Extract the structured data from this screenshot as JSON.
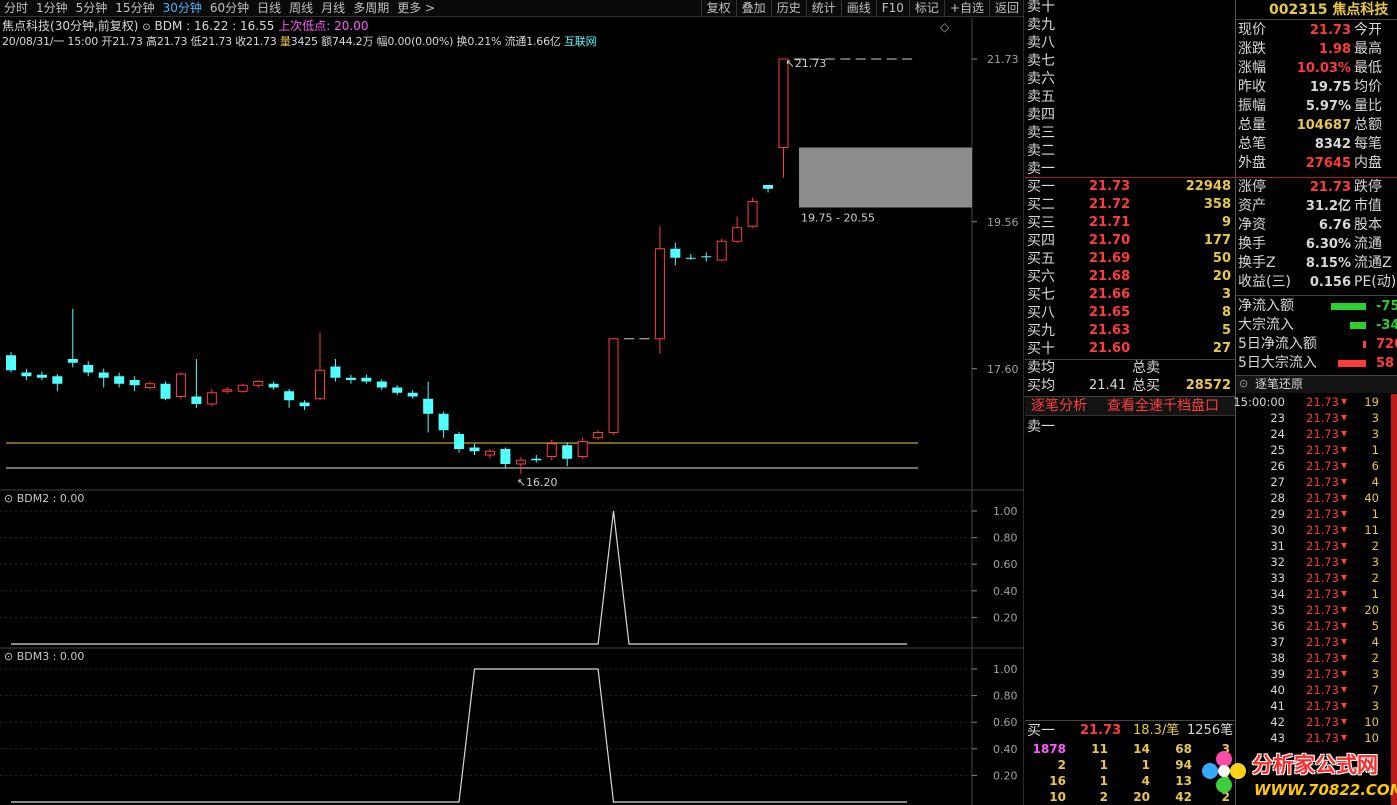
{
  "toolbar": {
    "timeframes": [
      "分时",
      "1分钟",
      "5分钟",
      "15分钟",
      "30分钟",
      "60分钟",
      "日线",
      "周线",
      "月线",
      "多周期",
      "更多 >"
    ],
    "selected_index": 4,
    "tools": [
      "复权",
      "叠加",
      "历史",
      "统计",
      "画线",
      "F10",
      "标记",
      "+自选",
      "返回"
    ]
  },
  "chart_header": {
    "stock": "焦点科技",
    "mode": "(30分钟,前复权)",
    "indicator": "BDM : 16.22 : 16.55",
    "last_low_label": "上次低点",
    "last_low_value": "20.00"
  },
  "bar_info": {
    "date": "20/08/31/一 15:00",
    "open_l": "开",
    "open": "21.73",
    "high_l": "高",
    "high": "21.73",
    "low_l": "低",
    "low": "21.73",
    "close_l": "收",
    "close": "21.73",
    "vol_l": "量",
    "vol": "3425",
    "amt_l": "额",
    "amt": "744.2万",
    "chg_l": "幅",
    "chg": "0.00(0.00%)",
    "turn_l": "换",
    "turn": "0.21%",
    "float_l": "流通",
    "float": "1.66亿",
    "sector": "互联网"
  },
  "price_axis": [
    "21.73",
    "19.56",
    "17.60"
  ],
  "chart_labels": {
    "high": "21.73",
    "low": "16.20",
    "box": "19.75 - 20.55"
  },
  "sub1": {
    "title": "BDM2 : 0.00",
    "ticks": [
      "1.00",
      "0.80",
      "0.60",
      "0.40",
      "0.20"
    ]
  },
  "sub2": {
    "title": "BDM3 : 0.00",
    "ticks": [
      "1.00",
      "0.80",
      "0.60",
      "0.40",
      "0.20"
    ]
  },
  "candles": [
    {
      "o": 17.58,
      "c": 17.78,
      "h": 17.82,
      "l": 17.55,
      "up": false
    },
    {
      "o": 17.55,
      "c": 17.5,
      "h": 17.6,
      "l": 17.45,
      "up": false
    },
    {
      "o": 17.52,
      "c": 17.48,
      "h": 17.56,
      "l": 17.45,
      "up": false
    },
    {
      "o": 17.5,
      "c": 17.4,
      "h": 17.53,
      "l": 17.3,
      "up": false
    },
    {
      "o": 17.73,
      "c": 17.68,
      "h": 18.4,
      "l": 17.62,
      "up": false
    },
    {
      "o": 17.65,
      "c": 17.55,
      "h": 17.7,
      "l": 17.5,
      "up": false
    },
    {
      "o": 17.55,
      "c": 17.48,
      "h": 17.6,
      "l": 17.35,
      "up": false
    },
    {
      "o": 17.5,
      "c": 17.4,
      "h": 17.55,
      "l": 17.35,
      "up": false
    },
    {
      "o": 17.45,
      "c": 17.38,
      "h": 17.5,
      "l": 17.3,
      "up": false
    },
    {
      "o": 17.35,
      "c": 17.4,
      "h": 17.43,
      "l": 17.32,
      "up": true
    },
    {
      "o": 17.4,
      "c": 17.2,
      "h": 17.43,
      "l": 17.18,
      "up": false
    },
    {
      "o": 17.23,
      "c": 17.53,
      "h": 17.55,
      "l": 17.2,
      "up": true
    },
    {
      "o": 17.23,
      "c": 17.13,
      "h": 17.73,
      "l": 17.08,
      "up": false
    },
    {
      "o": 17.13,
      "c": 17.28,
      "h": 17.33,
      "l": 17.1,
      "up": true
    },
    {
      "o": 17.3,
      "c": 17.32,
      "h": 17.35,
      "l": 17.27,
      "up": true
    },
    {
      "o": 17.3,
      "c": 17.38,
      "h": 17.4,
      "l": 17.28,
      "up": true
    },
    {
      "o": 17.38,
      "c": 17.43,
      "h": 17.45,
      "l": 17.35,
      "up": true
    },
    {
      "o": 17.4,
      "c": 17.35,
      "h": 17.43,
      "l": 17.32,
      "up": false
    },
    {
      "o": 17.3,
      "c": 17.18,
      "h": 17.33,
      "l": 17.08,
      "up": false
    },
    {
      "o": 17.15,
      "c": 17.1,
      "h": 17.18,
      "l": 17.05,
      "up": false
    },
    {
      "o": 17.2,
      "c": 17.58,
      "h": 18.08,
      "l": 17.18,
      "up": true
    },
    {
      "o": 17.63,
      "c": 17.48,
      "h": 17.73,
      "l": 17.43,
      "up": false
    },
    {
      "o": 17.48,
      "c": 17.45,
      "h": 17.52,
      "l": 17.4,
      "up": false
    },
    {
      "o": 17.48,
      "c": 17.43,
      "h": 17.52,
      "l": 17.4,
      "up": false
    },
    {
      "o": 17.43,
      "c": 17.35,
      "h": 17.46,
      "l": 17.32,
      "up": false
    },
    {
      "o": 17.35,
      "c": 17.28,
      "h": 17.38,
      "l": 17.25,
      "up": false
    },
    {
      "o": 17.28,
      "c": 17.23,
      "h": 17.31,
      "l": 17.2,
      "up": false
    },
    {
      "o": 17.2,
      "c": 17.0,
      "h": 17.43,
      "l": 16.75,
      "up": false
    },
    {
      "o": 17.0,
      "c": 16.78,
      "h": 17.03,
      "l": 16.68,
      "up": false
    },
    {
      "o": 16.73,
      "c": 16.53,
      "h": 16.76,
      "l": 16.48,
      "up": false
    },
    {
      "o": 16.55,
      "c": 16.5,
      "h": 16.6,
      "l": 16.45,
      "up": false
    },
    {
      "o": 16.45,
      "c": 16.5,
      "h": 16.53,
      "l": 16.4,
      "up": true
    },
    {
      "o": 16.53,
      "c": 16.33,
      "h": 16.55,
      "l": 16.28,
      "up": false
    },
    {
      "o": 16.33,
      "c": 16.38,
      "h": 16.42,
      "l": 16.2,
      "up": true
    },
    {
      "o": 16.4,
      "c": 16.38,
      "h": 16.45,
      "l": 16.35,
      "up": false
    },
    {
      "o": 16.43,
      "c": 16.6,
      "h": 16.65,
      "l": 16.38,
      "up": true
    },
    {
      "o": 16.58,
      "c": 16.4,
      "h": 16.62,
      "l": 16.3,
      "up": false
    },
    {
      "o": 16.43,
      "c": 16.63,
      "h": 16.68,
      "l": 16.4,
      "up": true
    },
    {
      "o": 16.68,
      "c": 16.75,
      "h": 16.78,
      "l": 16.65,
      "up": true
    },
    {
      "o": 16.75,
      "c": 18.0,
      "h": 18.0,
      "l": 16.72,
      "up": true
    },
    {
      "o": 18.0,
      "c": 18.0,
      "h": 18.0,
      "l": 18.0,
      "up": false
    },
    {
      "o": 18.0,
      "c": 18.0,
      "h": 18.0,
      "l": 18.0,
      "up": false
    },
    {
      "o": 18.0,
      "c": 19.2,
      "h": 19.5,
      "l": 17.8,
      "up": true
    },
    {
      "o": 19.2,
      "c": 19.08,
      "h": 19.28,
      "l": 18.98,
      "up": false
    },
    {
      "o": 19.08,
      "c": 19.08,
      "h": 19.13,
      "l": 19.05,
      "up": false
    },
    {
      "o": 19.1,
      "c": 19.1,
      "h": 19.15,
      "l": 19.03,
      "up": false
    },
    {
      "o": 19.05,
      "c": 19.3,
      "h": 19.33,
      "l": 19.03,
      "up": true
    },
    {
      "o": 19.3,
      "c": 19.48,
      "h": 19.63,
      "l": 19.28,
      "up": true
    },
    {
      "o": 19.5,
      "c": 19.83,
      "h": 19.88,
      "l": 19.48,
      "up": true
    },
    {
      "o": 20.05,
      "c": 20.0,
      "h": 20.05,
      "l": 19.95,
      "up": false
    },
    {
      "o": 20.55,
      "c": 21.73,
      "h": 21.73,
      "l": 20.15,
      "up": true
    },
    {
      "o": 21.73,
      "c": 21.73,
      "h": 21.73,
      "l": 21.73,
      "up": false
    },
    {
      "o": 21.73,
      "c": 21.73,
      "h": 21.73,
      "l": 21.73,
      "up": false
    },
    {
      "o": 21.73,
      "c": 21.73,
      "h": 21.73,
      "l": 21.73,
      "up": false
    },
    {
      "o": 21.73,
      "c": 21.73,
      "h": 21.73,
      "l": 21.73,
      "up": false
    },
    {
      "o": 21.73,
      "c": 21.73,
      "h": 21.73,
      "l": 21.73,
      "up": false
    },
    {
      "o": 21.73,
      "c": 21.73,
      "h": 21.73,
      "l": 21.73,
      "up": false
    },
    {
      "o": 21.73,
      "c": 21.73,
      "h": 21.73,
      "l": 21.73,
      "up": false
    },
    {
      "o": 21.73,
      "c": 21.73,
      "h": 21.73,
      "l": 21.73,
      "up": false
    }
  ],
  "bdm2": [
    0,
    0,
    0,
    0,
    0,
    0,
    0,
    0,
    0,
    0,
    0,
    0,
    0,
    0,
    0,
    0,
    0,
    0,
    0,
    0,
    0,
    0,
    0,
    0,
    0,
    0,
    0,
    0,
    0,
    0,
    0,
    0,
    0,
    0,
    0,
    0,
    0,
    0,
    0,
    1,
    0,
    0,
    0,
    0,
    0,
    0,
    0,
    0,
    0,
    0,
    0,
    0,
    0,
    0,
    0,
    0,
    0,
    0,
    0
  ],
  "bdm3": [
    0,
    0,
    0,
    0,
    0,
    0,
    0,
    0,
    0,
    0,
    0,
    0,
    0,
    0,
    0,
    0,
    0,
    0,
    0,
    0,
    0,
    0,
    0,
    0,
    0,
    0,
    0,
    0,
    0,
    0,
    1,
    1,
    1,
    1,
    1,
    1,
    1,
    1,
    1,
    0,
    0,
    0,
    0,
    0,
    0,
    0,
    0,
    0,
    0,
    0,
    0,
    0,
    0,
    0,
    0,
    0,
    0,
    0,
    0
  ],
  "orderbook": {
    "sells": [
      "卖十",
      "卖九",
      "卖八",
      "卖七",
      "卖六",
      "卖五",
      "卖四",
      "卖三",
      "卖二",
      "卖一"
    ],
    "buys": [
      {
        "l": "买一",
        "p": "21.73",
        "v": "22948"
      },
      {
        "l": "买二",
        "p": "21.72",
        "v": "358"
      },
      {
        "l": "买三",
        "p": "21.71",
        "v": "9"
      },
      {
        "l": "买四",
        "p": "21.70",
        "v": "177"
      },
      {
        "l": "买五",
        "p": "21.69",
        "v": "50"
      },
      {
        "l": "买六",
        "p": "21.68",
        "v": "20"
      },
      {
        "l": "买七",
        "p": "21.66",
        "v": "3"
      },
      {
        "l": "买八",
        "p": "21.65",
        "v": "8"
      },
      {
        "l": "买九",
        "p": "21.63",
        "v": "5"
      },
      {
        "l": "买十",
        "p": "21.60",
        "v": "27"
      }
    ],
    "sell_avg_l": "卖均",
    "total_sell_l": "总卖",
    "buy_avg_l": "买均",
    "buy_avg": "21.41",
    "total_buy_l": "总买",
    "total_buy": "28572",
    "link1": "逐笔分析",
    "link2": "查看全速千档盘口",
    "sell1": "卖一",
    "bottom_buy_l": "买一",
    "bottom_price": "21.73",
    "bottom_per": "18.3/笔",
    "bottom_count": "1256笔",
    "queue": [
      [
        "1878",
        "11",
        "14",
        "68",
        "3"
      ],
      [
        "2",
        "1",
        "1",
        "94",
        "2"
      ],
      [
        "16",
        "1",
        "4",
        "13",
        "2"
      ],
      [
        "10",
        "2",
        "20",
        "42",
        "2"
      ]
    ]
  },
  "quote": {
    "code": "002315",
    "name": "焦点科技",
    "rows": [
      [
        "现价",
        "21.73",
        "今开",
        "rd"
      ],
      [
        "涨跌",
        "1.98",
        "最高",
        "rd"
      ],
      [
        "涨幅",
        "10.03%",
        "最低",
        "rd"
      ],
      [
        "昨收",
        "19.75",
        "均价",
        "wh"
      ],
      [
        "振幅",
        "5.97%",
        "量比",
        "wh"
      ],
      [
        "总量",
        "104687",
        "总额",
        "yl"
      ],
      [
        "总笔",
        "8342",
        "每笔",
        "wh"
      ],
      [
        "外盘",
        "27645",
        "内盘",
        "rd"
      ]
    ],
    "rows2": [
      [
        "涨停",
        "21.73",
        "跌停",
        "rd"
      ],
      [
        "资产",
        "31.2亿",
        "市值",
        "wh"
      ],
      [
        "净资",
        "6.76",
        "股本",
        "wh"
      ],
      [
        "换手",
        "6.30%",
        "流通",
        "wh"
      ],
      [
        "换手Z",
        "8.15%",
        "流通Z",
        "wh"
      ],
      [
        "收益(三)",
        "0.156",
        "PE(动)",
        "wh"
      ]
    ],
    "flows": [
      [
        "净流入额",
        "-75",
        "gr",
        35
      ],
      [
        "大宗流入",
        "-34",
        "gr",
        16
      ],
      [
        "5日净流入额",
        "720",
        "rd",
        3
      ],
      [
        "5日大宗流入",
        "58",
        "rd",
        28
      ]
    ]
  },
  "ticks": {
    "title": "逐笔还原",
    "arrow": "▼",
    "rows": [
      [
        "15:00:00",
        "21.73",
        "19"
      ],
      [
        "23",
        "21.73",
        "3"
      ],
      [
        "24",
        "21.73",
        "3"
      ],
      [
        "25",
        "21.73",
        "1"
      ],
      [
        "26",
        "21.73",
        "6"
      ],
      [
        "27",
        "21.73",
        "4"
      ],
      [
        "28",
        "21.73",
        "40"
      ],
      [
        "29",
        "21.73",
        "1"
      ],
      [
        "30",
        "21.73",
        "11"
      ],
      [
        "31",
        "21.73",
        "2"
      ],
      [
        "32",
        "21.73",
        "3"
      ],
      [
        "33",
        "21.73",
        "2"
      ],
      [
        "34",
        "21.73",
        "1"
      ],
      [
        "35",
        "21.73",
        "20"
      ],
      [
        "36",
        "21.73",
        "5"
      ],
      [
        "37",
        "21.73",
        "4"
      ],
      [
        "38",
        "21.73",
        "2"
      ],
      [
        "39",
        "21.73",
        "3"
      ],
      [
        "40",
        "21.73",
        "7"
      ],
      [
        "41",
        "21.73",
        "3"
      ],
      [
        "42",
        "21.73",
        "10"
      ],
      [
        "43",
        "21.73",
        "10"
      ]
    ]
  },
  "watermark": {
    "cn": "分析家公式网",
    "url": "WWW.70822.COM"
  },
  "colors": {
    "up": "#ff3c3c",
    "down": "#52ffff",
    "grid": "#303030",
    "line": "#d8d8d8",
    "yellowline": "#e8c84a"
  }
}
